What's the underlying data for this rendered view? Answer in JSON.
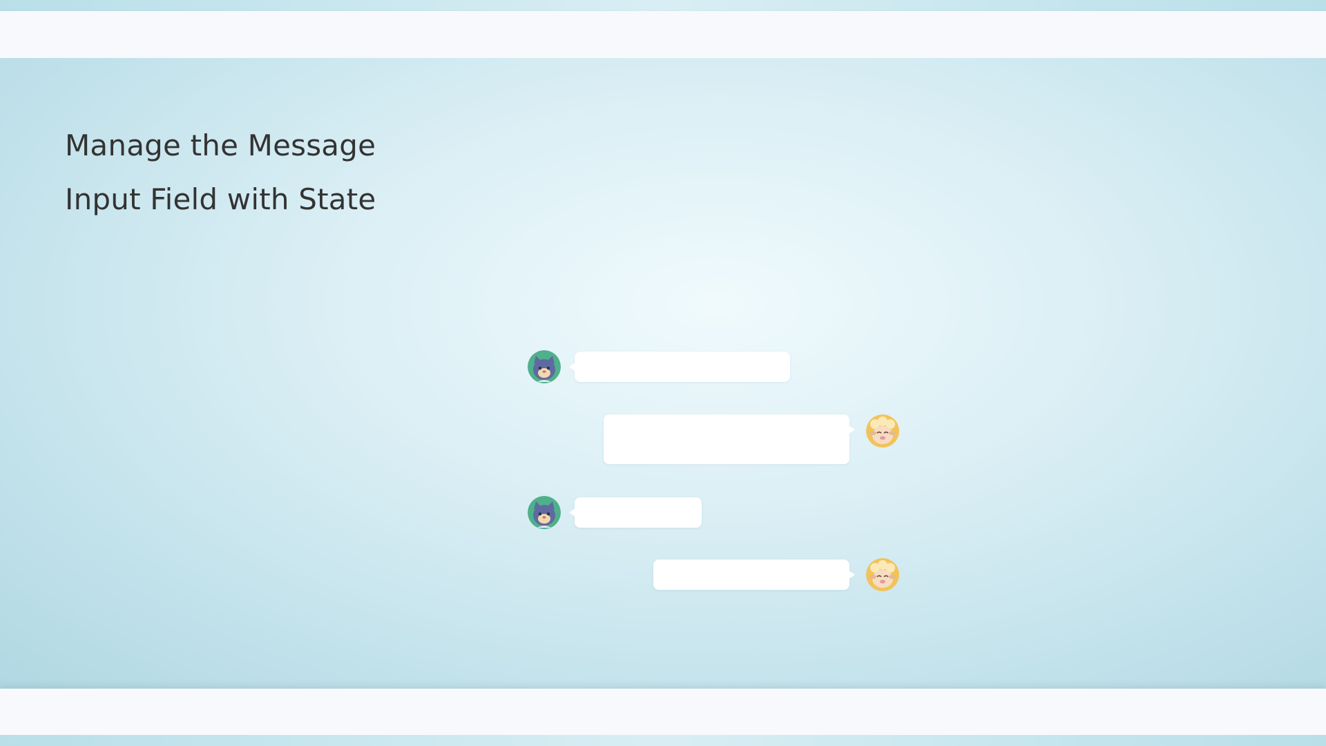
{
  "page": {
    "title_line1": "Manage the Message",
    "title_line2": "Input Field with State"
  },
  "chat": {
    "messages": [
      {
        "sender": "cat",
        "side": "left",
        "text": "",
        "avatar_icon": "cat-avatar-icon"
      },
      {
        "sender": "sheep",
        "side": "right",
        "text": "",
        "avatar_icon": "sheep-avatar-icon"
      },
      {
        "sender": "cat",
        "side": "left",
        "text": "",
        "avatar_icon": "cat-avatar-icon"
      },
      {
        "sender": "sheep",
        "side": "right",
        "text": "",
        "avatar_icon": "sheep-avatar-icon"
      }
    ]
  },
  "colors": {
    "cat_avatar_bg": "#4fb08c",
    "cat_fur": "#5e6aa0",
    "sheep_avatar_bg": "#f2c35a",
    "sheep_face": "#f6dcc2",
    "bubble": "#ffffff",
    "title_text": "#333333"
  }
}
